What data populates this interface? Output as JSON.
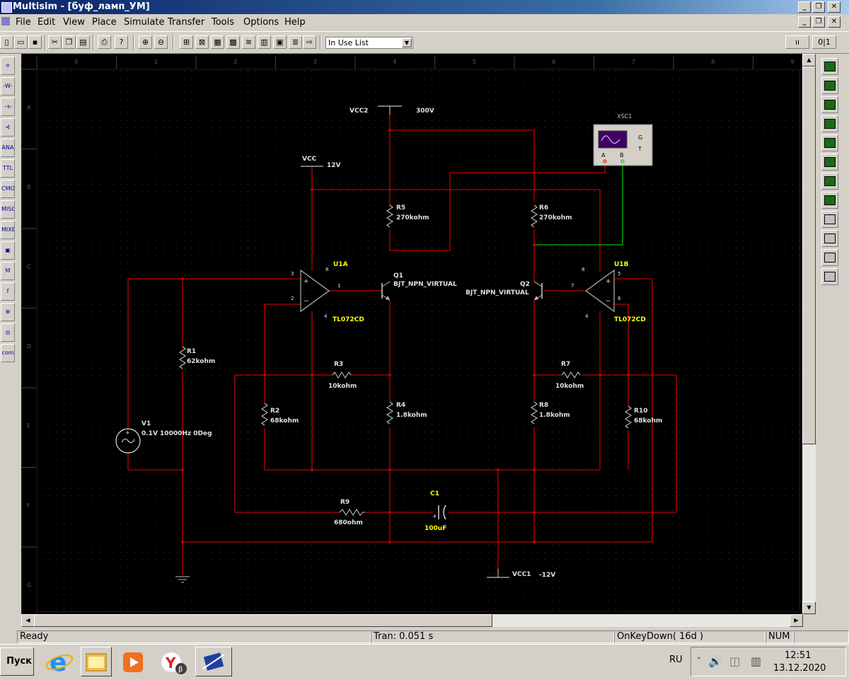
{
  "window": {
    "title": "Multisim - [буф_ламп_УМ]",
    "buttons": {
      "minimize": "_",
      "restore": "❐",
      "close": "✕"
    }
  },
  "menu": {
    "items": [
      "File",
      "Edit",
      "View",
      "Place",
      "Simulate",
      "Transfer",
      "Tools",
      "Options",
      "Help"
    ]
  },
  "toolbar": {
    "in_use_list": "In Use List"
  },
  "ruler": {
    "columns": [
      "0",
      "1",
      "2",
      "3",
      "4",
      "5",
      "6",
      "7",
      "8",
      "9"
    ],
    "rows": [
      "A",
      "B",
      "C",
      "D",
      "E",
      "F",
      "G"
    ]
  },
  "palette_left": [
    {
      "label": "≑",
      "icon": "source-icon"
    },
    {
      "label": "-W-",
      "icon": "basic-icon"
    },
    {
      "label": "⊣▹",
      "icon": "diode-icon"
    },
    {
      "label": "⊰",
      "icon": "transistor-icon"
    },
    {
      "label": "ANA",
      "icon": "analog-icon"
    },
    {
      "label": "TTL",
      "icon": "ttl-icon"
    },
    {
      "label": "CMOS",
      "icon": "cmos-icon"
    },
    {
      "label": "MISC",
      "icon": "misc-digital-icon"
    },
    {
      "label": "MIXED",
      "icon": "mixed-icon"
    },
    {
      "label": "▣",
      "icon": "indicator-icon"
    },
    {
      "label": "M",
      "icon": "misc-icon"
    },
    {
      "label": "f",
      "icon": "rf-icon"
    },
    {
      "label": "⊕",
      "icon": "electromech-icon"
    },
    {
      "label": "◎",
      "icon": "ladder-icon"
    },
    {
      "label": "com",
      "icon": "com-icon"
    }
  ],
  "schematic": {
    "vcc2": {
      "name": "VCC2",
      "value": "300V"
    },
    "vcc": {
      "name": "VCC",
      "value": "12V"
    },
    "vcc1": {
      "name": "VCC1",
      "value": "-12V"
    },
    "xsc1": {
      "name": "XSC1",
      "a": "A",
      "b": "B",
      "g": "G",
      "t": "T"
    },
    "r5": {
      "name": "R5",
      "value": "270kohm"
    },
    "r6": {
      "name": "R6",
      "value": "270kohm"
    },
    "u1a": {
      "name": "U1A",
      "model": "TL072CD",
      "p3": "3",
      "p8": "8",
      "p1": "1",
      "p2": "2",
      "p4": "4"
    },
    "u1b": {
      "name": "U1B",
      "model": "TL072CD",
      "p8": "8",
      "p5": "5",
      "p7": "7",
      "p6": "6",
      "p4": "4"
    },
    "q1": {
      "name": "Q1",
      "model": "BJT_NPN_VIRTUAL"
    },
    "q2": {
      "name": "Q2",
      "model": "BJT_NPN_VIRTUAL"
    },
    "r1": {
      "name": "R1",
      "value": "62kohm"
    },
    "r3": {
      "name": "R3",
      "value": "10kohm"
    },
    "r7": {
      "name": "R7",
      "value": "10kohm"
    },
    "r2": {
      "name": "R2",
      "value": "68kohm"
    },
    "r4": {
      "name": "R4",
      "value": "1.8kohm"
    },
    "r8": {
      "name": "R8",
      "value": "1.8kohm"
    },
    "r10": {
      "name": "R10",
      "value": "68kohm"
    },
    "v1": {
      "name": "V1",
      "value": "0.1V 10000Hz 0Deg"
    },
    "r9": {
      "name": "R9",
      "value": "680ohm"
    },
    "c1": {
      "name": "C1",
      "value": "100uF"
    }
  },
  "status": {
    "ready": "Ready",
    "tran": "Tran: 0.051 s",
    "event": "OnKeyDown( 16d )",
    "num": "NUM"
  },
  "taskbar": {
    "start": "Пуск",
    "lang": "RU",
    "time": "12:51",
    "date": "13.12.2020"
  },
  "colors": {
    "wire": "#c00000",
    "probe_wire": "#00c000",
    "label_yellow": "#ffff00",
    "canvas": "#000000"
  }
}
